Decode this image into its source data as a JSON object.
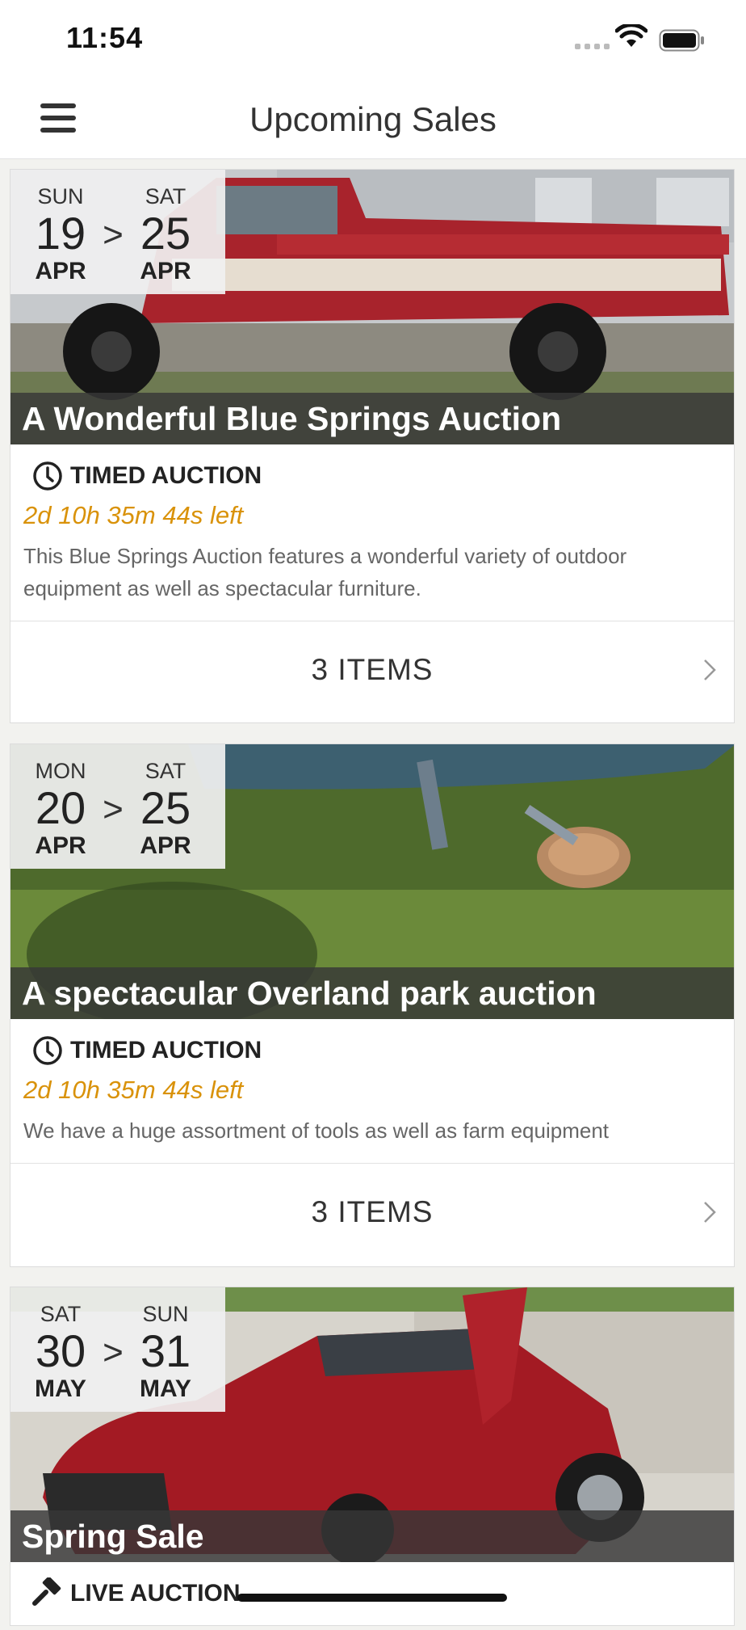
{
  "status_bar": {
    "time": "11:54",
    "icons": [
      "signal-icon",
      "wifi-icon",
      "battery-icon"
    ]
  },
  "nav": {
    "title": "Upcoming Sales",
    "menu_icon": "hamburger-menu-icon"
  },
  "colors": {
    "accent_time": "#d9920a",
    "overlay": "#373737",
    "background": "#f2f2ef"
  },
  "sales": [
    {
      "start": {
        "dow": "SUN",
        "day": "19",
        "month": "APR"
      },
      "end": {
        "dow": "SAT",
        "day": "25",
        "month": "APR"
      },
      "arrow": ">",
      "title": "A Wonderful Blue Springs Auction",
      "type": "TIMED AUCTION",
      "type_icon": "clock-icon",
      "time_left": "2d 10h 35m 44s left",
      "description": "This Blue Springs Auction features a wonderful variety of outdoor equipment as well as spectacular furniture.",
      "items": "3 ITEMS"
    },
    {
      "start": {
        "dow": "MON",
        "day": "20",
        "month": "APR"
      },
      "end": {
        "dow": "SAT",
        "day": "25",
        "month": "APR"
      },
      "arrow": ">",
      "title": "A spectacular Overland park auction",
      "type": "TIMED AUCTION",
      "type_icon": "clock-icon",
      "time_left": "2d 10h 35m 44s left",
      "description": "We have a huge assortment of tools as well as farm equipment",
      "items": "3 ITEMS"
    },
    {
      "start": {
        "dow": "SAT",
        "day": "30",
        "month": "MAY"
      },
      "end": {
        "dow": "SUN",
        "day": "31",
        "month": "MAY"
      },
      "arrow": ">",
      "title": "Spring Sale",
      "type": "LIVE AUCTION",
      "type_icon": "gavel-icon"
    }
  ]
}
